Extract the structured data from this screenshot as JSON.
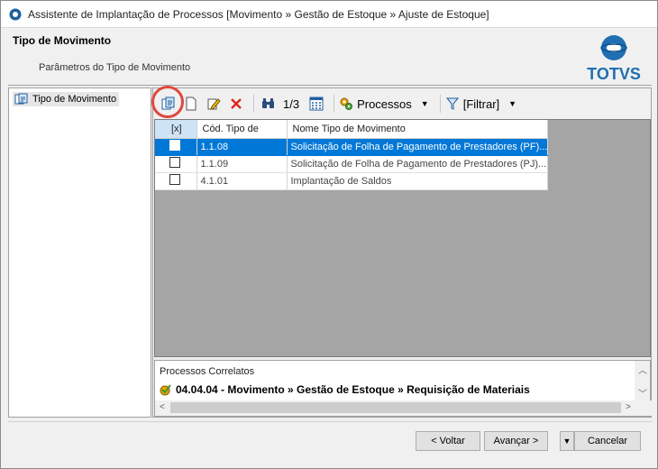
{
  "window": {
    "title": "Assistente de Implantação de Processos [Movimento » Gestão de Estoque » Ajuste de Estoque]"
  },
  "header": {
    "title": "Tipo de Movimento",
    "subtitle": "Parâmetros do Tipo de Movimento",
    "logo_text": "TOTVS"
  },
  "tree": {
    "items": [
      {
        "label": "Tipo de Movimento",
        "icon": "tree-node-icon"
      }
    ]
  },
  "toolbar": {
    "page_indicator": "1/3",
    "processos_label": "Processos",
    "filtrar_label": "[Filtrar]"
  },
  "grid": {
    "columns": [
      "[x]",
      "Cód. Tipo de",
      "Nome Tipo de Movimento"
    ],
    "rows": [
      {
        "code": "1.1.08",
        "name": "Solicitação de Folha de Pagamento de Prestadores (PF)...",
        "selected": true
      },
      {
        "code": "1.1.09",
        "name": "Solicitação de Folha de Pagamento de Prestadores (PJ)...",
        "selected": false
      },
      {
        "code": "4.1.01",
        "name": "Implantação de Saldos",
        "selected": false
      }
    ]
  },
  "correlatos": {
    "title": "Processos Correlatos",
    "item": "04.04.04 - Movimento » Gestão de Estoque » Requisição de Materiais"
  },
  "footer": {
    "voltar": "< Voltar",
    "avancar": "Avançar >",
    "cancelar": "Cancelar"
  },
  "colors": {
    "selection": "#0078d7",
    "highlight_ring": "#e0473e",
    "logo_blue": "#1f6fb2"
  }
}
